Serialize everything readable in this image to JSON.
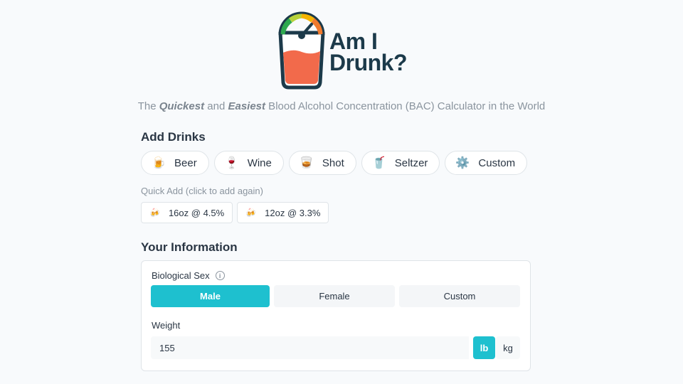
{
  "logo": {
    "line1": "Am I",
    "line2": "Drunk?",
    "icon": "gauge-cup-icon"
  },
  "tagline": {
    "pre": "The ",
    "quickest": "Quickest",
    "mid": " and ",
    "easiest": "Easiest",
    "post": " Blood Alcohol Concentration (BAC) Calculator in the World"
  },
  "add_drinks": {
    "title": "Add Drinks",
    "buttons": [
      {
        "label": "Beer",
        "icon": "beer-mug-icon",
        "glyph": "🍺"
      },
      {
        "label": "Wine",
        "icon": "wine-glass-icon",
        "glyph": "🍷"
      },
      {
        "label": "Shot",
        "icon": "shot-glass-icon",
        "glyph": "🥃"
      },
      {
        "label": "Seltzer",
        "icon": "seltzer-can-icon",
        "glyph": "🥤"
      },
      {
        "label": "Custom",
        "icon": "gear-icon",
        "glyph": "⚙️"
      }
    ],
    "quick_add_label": "Quick Add (click to add again)",
    "quick_add": [
      {
        "label": "16oz @ 4.5%",
        "icon": "beer-cheers-icon",
        "glyph": "🍻"
      },
      {
        "label": "12oz @ 3.3%",
        "icon": "beer-cheers-icon",
        "glyph": "🍻"
      }
    ]
  },
  "your_info": {
    "title": "Your Information",
    "sex_label": "Biological Sex",
    "info_glyph": "i",
    "sex_options": [
      "Male",
      "Female",
      "Custom"
    ],
    "sex_selected": "Male",
    "weight_label": "Weight",
    "weight_value": "155",
    "units": [
      "lb",
      "kg"
    ],
    "unit_selected": "lb"
  },
  "colors": {
    "accent": "#1ec0cf",
    "logo_navy": "#1c3a4a",
    "drink_red": "#f26a4b"
  }
}
